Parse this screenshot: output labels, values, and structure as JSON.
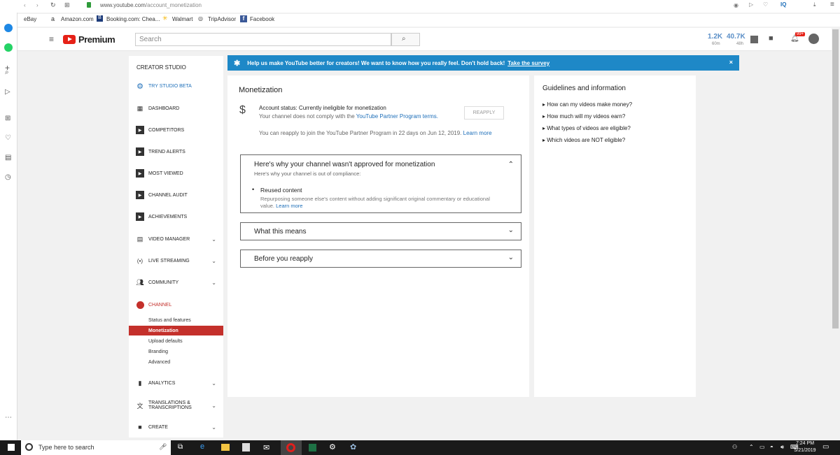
{
  "browser": {
    "url_host": "www.youtube.com",
    "url_path": "/account_monetization",
    "bookmarks": [
      "eBay",
      "Amazon.com",
      "Booking.com: Chea...",
      "Walmart",
      "TripAdvisor",
      "Facebook"
    ]
  },
  "header": {
    "logo_text": "Premium",
    "search_placeholder": "Search",
    "stat1_value": "1.2K",
    "stat1_label": "60m",
    "stat2_value": "40.7K",
    "stat2_label": "48h",
    "notif_badge": "99+"
  },
  "sidebar": {
    "title": "CREATOR STUDIO",
    "try_beta": "TRY STUDIO BETA",
    "dashboard": "DASHBOARD",
    "competitors": "COMPETITORS",
    "trend_alerts": "TREND ALERTS",
    "most_viewed": "MOST VIEWED",
    "channel_audit": "CHANNEL AUDIT",
    "achievements": "ACHIEVEMENTS",
    "video_manager": "VIDEO MANAGER",
    "live_streaming": "LIVE STREAMING",
    "community": "COMMUNITY",
    "channel": "CHANNEL",
    "sub_status": "Status and features",
    "sub_monetization": "Monetization",
    "sub_upload": "Upload defaults",
    "sub_branding": "Branding",
    "sub_advanced": "Advanced",
    "analytics": "ANALYTICS",
    "translations_1": "TRANSLATIONS &",
    "translations_2": "TRANSCRIPTIONS",
    "create": "CREATE"
  },
  "banner": {
    "text": "Help us make YouTube better for creators! We want to know how you really feel. Don't hold back!",
    "link": "Take the survey",
    "close": "×"
  },
  "monetization": {
    "title": "Monetization",
    "status": "Account status: Currently ineligible for monetization",
    "status_sub": "Your channel does not comply with the",
    "status_link": "YouTube Partner Program terms.",
    "reapply_button": "REAPPLY",
    "reapply_note": "You can reapply to join the YouTube Partner Program in 22 days on Jun 12, 2019.",
    "reapply_link": "Learn more",
    "acc1_title": "Here's why your channel wasn't approved for monetization",
    "acc1_sub": "Here's why your channel is out of compliance:",
    "reason_title": "Reused content",
    "reason_desc_1": "Repurposing someone else's content without adding significant original commentary or educational",
    "reason_desc_2": "value.",
    "reason_link": "Learn more",
    "acc2_title": "What this means",
    "acc3_title": "Before you reapply"
  },
  "guidelines": {
    "title": "Guidelines and information",
    "items": [
      "How can my videos make money?",
      "How much will my videos earn?",
      "What types of videos are eligible?",
      "Which videos are NOT eligible?"
    ]
  },
  "taskbar": {
    "search_placeholder": "Type here to search",
    "time": "7:24 PM",
    "date": "5/21/2019"
  },
  "colors": {
    "brand_red": "#c4302b",
    "banner_blue": "#1e88c7",
    "link_blue": "#1e6fb9"
  }
}
